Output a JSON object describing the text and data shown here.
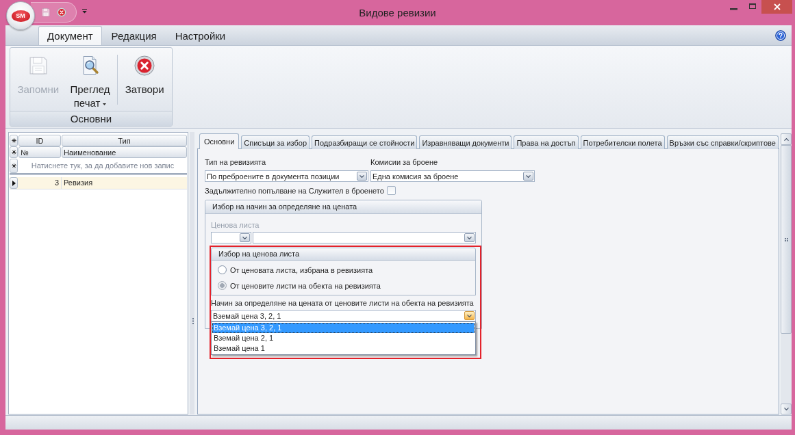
{
  "window": {
    "title": "Видове ревизии",
    "app_button": "SM"
  },
  "quick_access": [
    {
      "kind": "save",
      "disabled": true
    },
    {
      "kind": "close",
      "disabled": false
    }
  ],
  "ribbon": {
    "tabs": [
      {
        "label": "Документ",
        "selected": true
      },
      {
        "label": "Редакция",
        "selected": false
      },
      {
        "label": "Настройки",
        "selected": false
      }
    ],
    "groups": [
      {
        "label": "Основни",
        "buttons": [
          {
            "kind": "save",
            "label": "Запомни",
            "disabled": true,
            "dropdown": false,
            "separator": false
          },
          {
            "kind": "preview",
            "label": "Преглед печат",
            "disabled": false,
            "dropdown": true,
            "separator": false
          },
          {
            "kind": "close",
            "label": "Затвори",
            "disabled": false,
            "dropdown": false,
            "separator": true
          }
        ]
      }
    ]
  },
  "grid": {
    "header_bands": [
      [
        "ID",
        "Тип"
      ],
      [
        "№",
        "Наименование"
      ]
    ],
    "new_row_hint": "Натиснете тук, за да добавите нов запис",
    "rows": [
      {
        "cells": [
          "3",
          "Ревизия"
        ],
        "selected": true
      }
    ]
  },
  "detail": {
    "tabs": [
      {
        "label": "Основни",
        "selected": true
      },
      {
        "label": "Списъци за избор",
        "selected": false
      },
      {
        "label": "Подразбиращи се стойности",
        "selected": false
      },
      {
        "label": "Изравняващи документи",
        "selected": false
      },
      {
        "label": "Права на достъп",
        "selected": false
      },
      {
        "label": "Потребителски полета",
        "selected": false
      },
      {
        "label": "Връзки със справки/скриптове",
        "selected": false
      }
    ],
    "revision_type": {
      "label": "Тип на ревизията",
      "value": "По преброените в документа позиции"
    },
    "counting_commissions": {
      "label": "Комисии за броене",
      "value": "Една комисия за броене"
    },
    "employee_required": {
      "label": "Задължително попълване на Служител в броенето",
      "checked": false
    },
    "price_method": {
      "title": "Избор на начин за определяне на цената",
      "highlight_frame": true,
      "price_list": {
        "label": "Ценова листа",
        "disabled": true
      },
      "source": {
        "title": "Избор на ценова листа",
        "options": [
          {
            "label": "От ценовата листа, избрана в ревизията",
            "selected": false
          },
          {
            "label": "От ценовите листи на обекта на ревизията",
            "selected": true
          }
        ]
      },
      "method": {
        "label": "Начин за определяне на цената от ценовите листи на обекта на ревизията",
        "value": "Вземай цена 3, 2, 1",
        "expanded": true,
        "options": [
          {
            "label": "Вземай цена 3, 2, 1",
            "selected": true
          },
          {
            "label": "Вземай цена 2, 1",
            "selected": false
          },
          {
            "label": "Вземай цена 1",
            "selected": false
          }
        ]
      }
    }
  }
}
